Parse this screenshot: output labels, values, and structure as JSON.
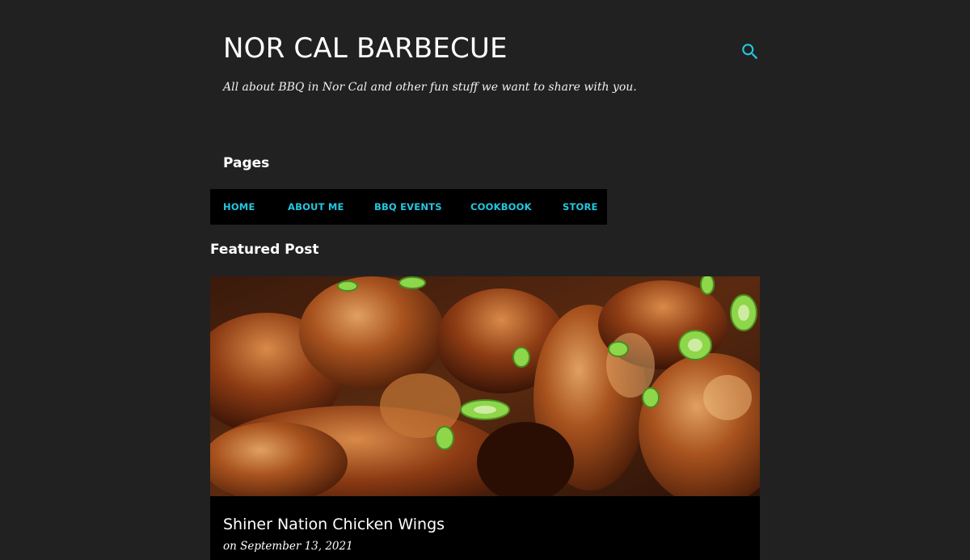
{
  "header": {
    "title": "NOR CAL BARBECUE",
    "description": "All about BBQ in Nor Cal and other fun stuff we want to share with you.",
    "search_icon": "search-icon"
  },
  "pages": {
    "heading": "Pages",
    "items": [
      {
        "label": "HOME"
      },
      {
        "label": "ABOUT ME"
      },
      {
        "label": "BBQ EVENTS"
      },
      {
        "label": "COOKBOOK"
      },
      {
        "label": "STORE"
      }
    ]
  },
  "featured": {
    "heading": "Featured Post",
    "post_title": "Shiner Nation Chicken Wings",
    "post_date": "on September 13, 2021"
  },
  "colors": {
    "background": "#212121",
    "nav_background": "#000000",
    "accent": "#24c6e0",
    "text": "#ffffff"
  }
}
